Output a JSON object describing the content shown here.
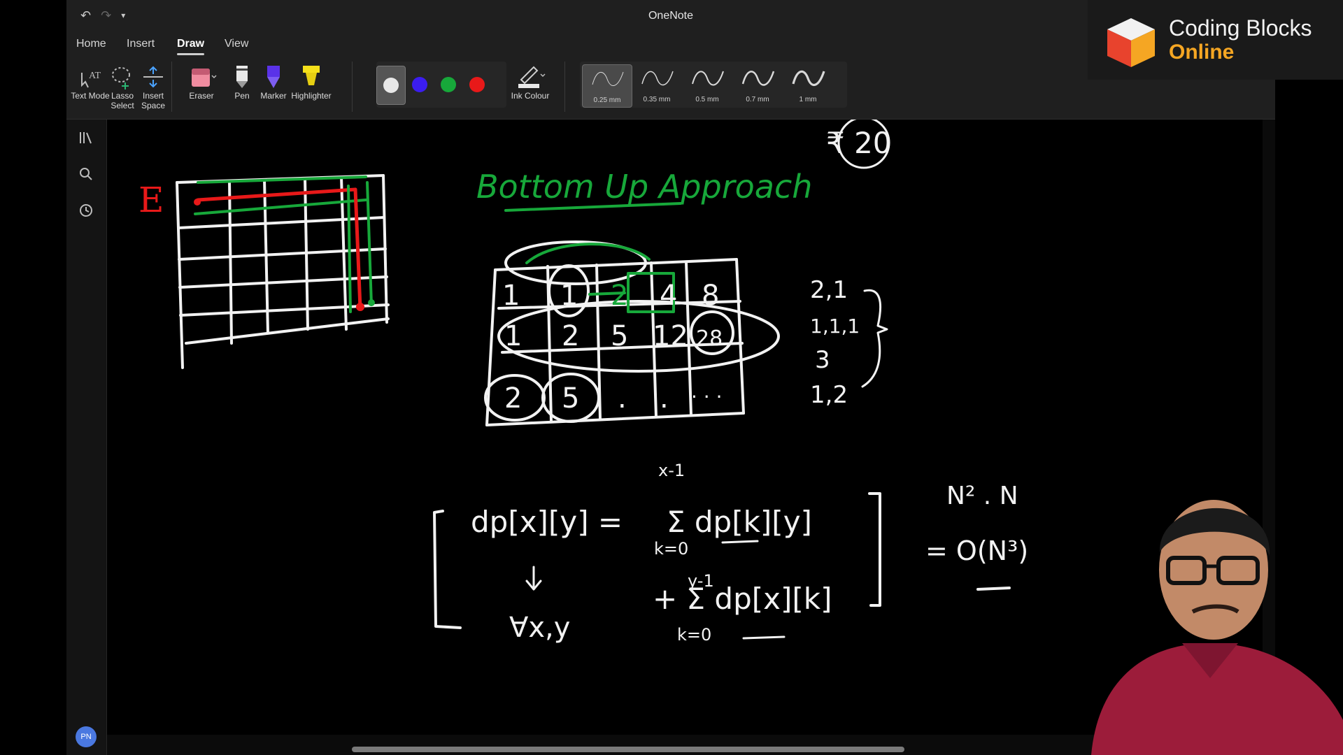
{
  "window": {
    "title": "OneNote"
  },
  "quick_access": {
    "undo_icon": "undo-icon",
    "redo_icon": "redo-icon",
    "customize_icon": "chevron-down-icon"
  },
  "tabs": [
    {
      "label": "Home"
    },
    {
      "label": "Insert"
    },
    {
      "label": "Draw",
      "active": true
    },
    {
      "label": "View"
    }
  ],
  "ribbon": {
    "text_mode": "Text Mode",
    "lasso_select": "Lasso Select",
    "insert_space": "Insert Space",
    "eraser": "Eraser",
    "pen": "Pen",
    "marker": "Marker",
    "highlighter": "Highlighter",
    "ink_colour": "Ink Colour",
    "pen_colors": [
      "#e8e8e8",
      "#3b1df0",
      "#17a83a",
      "#e81919"
    ],
    "selected_color_index": 0,
    "thickness": [
      "0.25 mm",
      "0.35 mm",
      "0.5 mm",
      "0.7 mm",
      "1 mm"
    ],
    "selected_thickness_index": 0
  },
  "sidenav": {
    "avatar_initials": "PN"
  },
  "brand": {
    "line1": "Coding Blocks",
    "line2": "Online",
    "accent": "#f5a623"
  },
  "canvas": {
    "ink": {
      "title": "Bottom Up Approach",
      "circled": "₹ 20",
      "left_mark": "E",
      "grid_row1": [
        "1",
        "1",
        "2",
        "4",
        "8"
      ],
      "grid_row2": [
        "1",
        "2",
        "5",
        "12",
        "28"
      ],
      "grid_row3": [
        "2",
        "5",
        ".",
        ".",
        ". . ."
      ],
      "list": [
        "2,1",
        "1,1,1",
        "3",
        "1,2"
      ],
      "eq_lhs": "dp[x][y] =",
      "eq_term1": "Σ dp[k][y]",
      "eq_term1_top": "x-1",
      "eq_term1_bot": "k=0",
      "eq_term2": "+ Σ dp[x][k]",
      "eq_term2_top": "y-1",
      "eq_term2_bot": "k=0",
      "for_all": "∀x,y",
      "complexity1": "N² . N",
      "complexity2": "= O(N³)"
    }
  }
}
